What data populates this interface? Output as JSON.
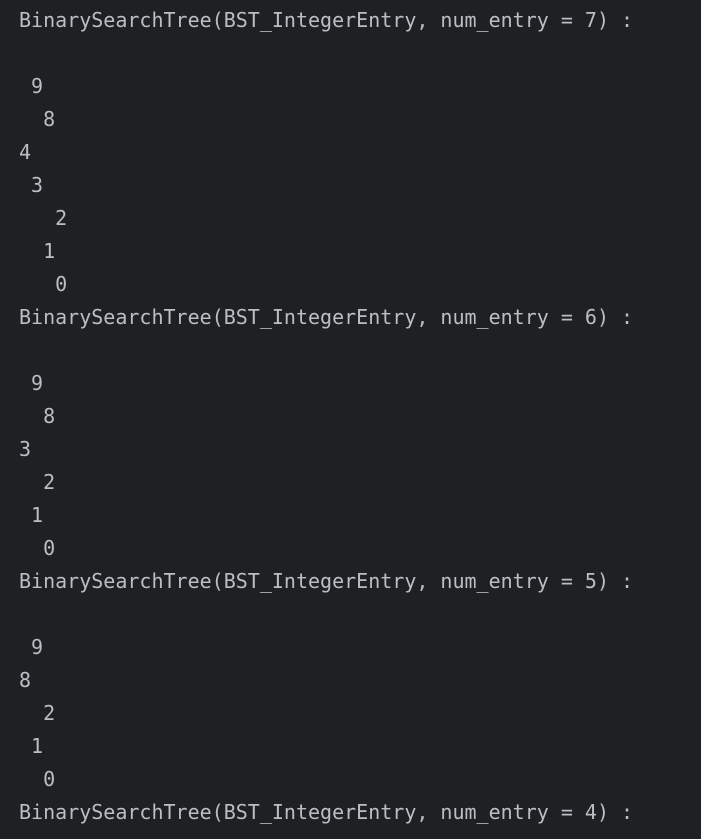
{
  "console": {
    "lines": [
      "BinarySearchTree(BST_IntegerEntry, num_entry = 7) :",
      "",
      " 9",
      "  8",
      "4",
      " 3",
      "   2",
      "  1",
      "   0",
      "BinarySearchTree(BST_IntegerEntry, num_entry = 6) :",
      "",
      " 9",
      "  8",
      "3",
      "  2",
      " 1",
      "  0",
      "BinarySearchTree(BST_IntegerEntry, num_entry = 5) :",
      "",
      " 9",
      "8",
      "  2",
      " 1",
      "  0",
      "BinarySearchTree(BST_IntegerEntry, num_entry = 4) :"
    ]
  }
}
